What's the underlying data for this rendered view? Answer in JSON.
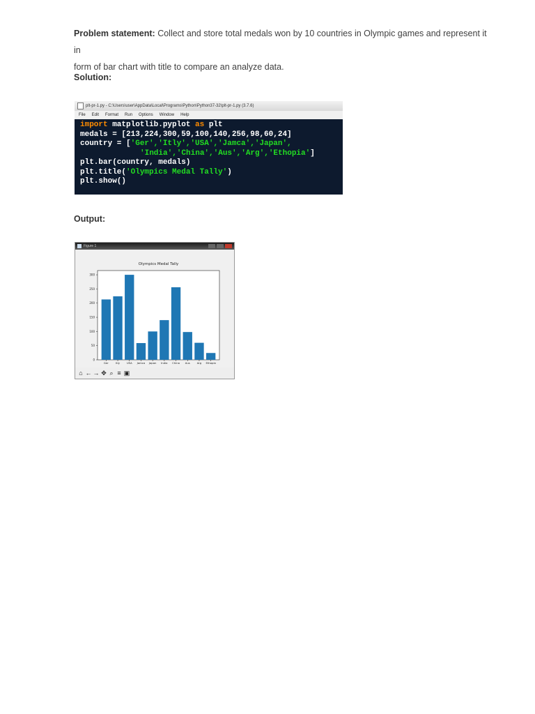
{
  "problem": {
    "label": "Problem statement:",
    "line1": "Collect and store total medals won by  10 countries in Olympic games and represent it in",
    "line2": "form of bar chart with title to compare an analyze data."
  },
  "solution_heading": "Solution:",
  "idle": {
    "title": "plt-pr-1.py - C:\\Users\\user\\AppData\\Local\\Programs\\Python\\Python37-32\\plt-pr-1.py (3.7.6)",
    "menu": [
      "File",
      "Edit",
      "Format",
      "Run",
      "Options",
      "Window",
      "Help"
    ],
    "code": {
      "l1_kw1": "import",
      "l1_mid": " matplotlib.pyplot ",
      "l1_kw2": "as",
      "l1_end": " plt",
      "l2": "medals = [213,224,300,59,100,140,256,98,60,24]",
      "l3_pre": "country = [",
      "l3_str": "'Ger','Itly','USA','Jamca','Japan',",
      "l4_str": "'India','China','Aus','Arg','Ethopia'",
      "l4_end": "]",
      "l5": "plt.bar(country, medals)",
      "l6_pre": "plt.title(",
      "l6_str": "'Olympics Medal Tally'",
      "l6_end": ")",
      "l7": "plt.show()"
    }
  },
  "output_heading": "Output:",
  "figure": {
    "window_title": "Figure 1",
    "toolbar_icons": [
      "home-icon",
      "back-icon",
      "forward-icon",
      "pan-icon",
      "zoom-icon",
      "configure-icon",
      "save-icon"
    ],
    "toolbar_glyphs": [
      "⌂",
      "←",
      "→",
      "✥",
      "⌕",
      "≡",
      "▣"
    ]
  },
  "chart_data": {
    "type": "bar",
    "title": "Olympics Medal Tally",
    "categories": [
      "Ger",
      "Itly",
      "USA",
      "Jamca",
      "Japan",
      "India",
      "China",
      "Aus",
      "Arg",
      "Ethopia"
    ],
    "values": [
      213,
      224,
      300,
      59,
      100,
      140,
      256,
      98,
      60,
      24
    ],
    "yticks": [
      0,
      50,
      100,
      150,
      200,
      250,
      300
    ],
    "ylim": [
      0,
      315
    ],
    "bar_color": "#1f77b4",
    "xlabel": "",
    "ylabel": ""
  }
}
